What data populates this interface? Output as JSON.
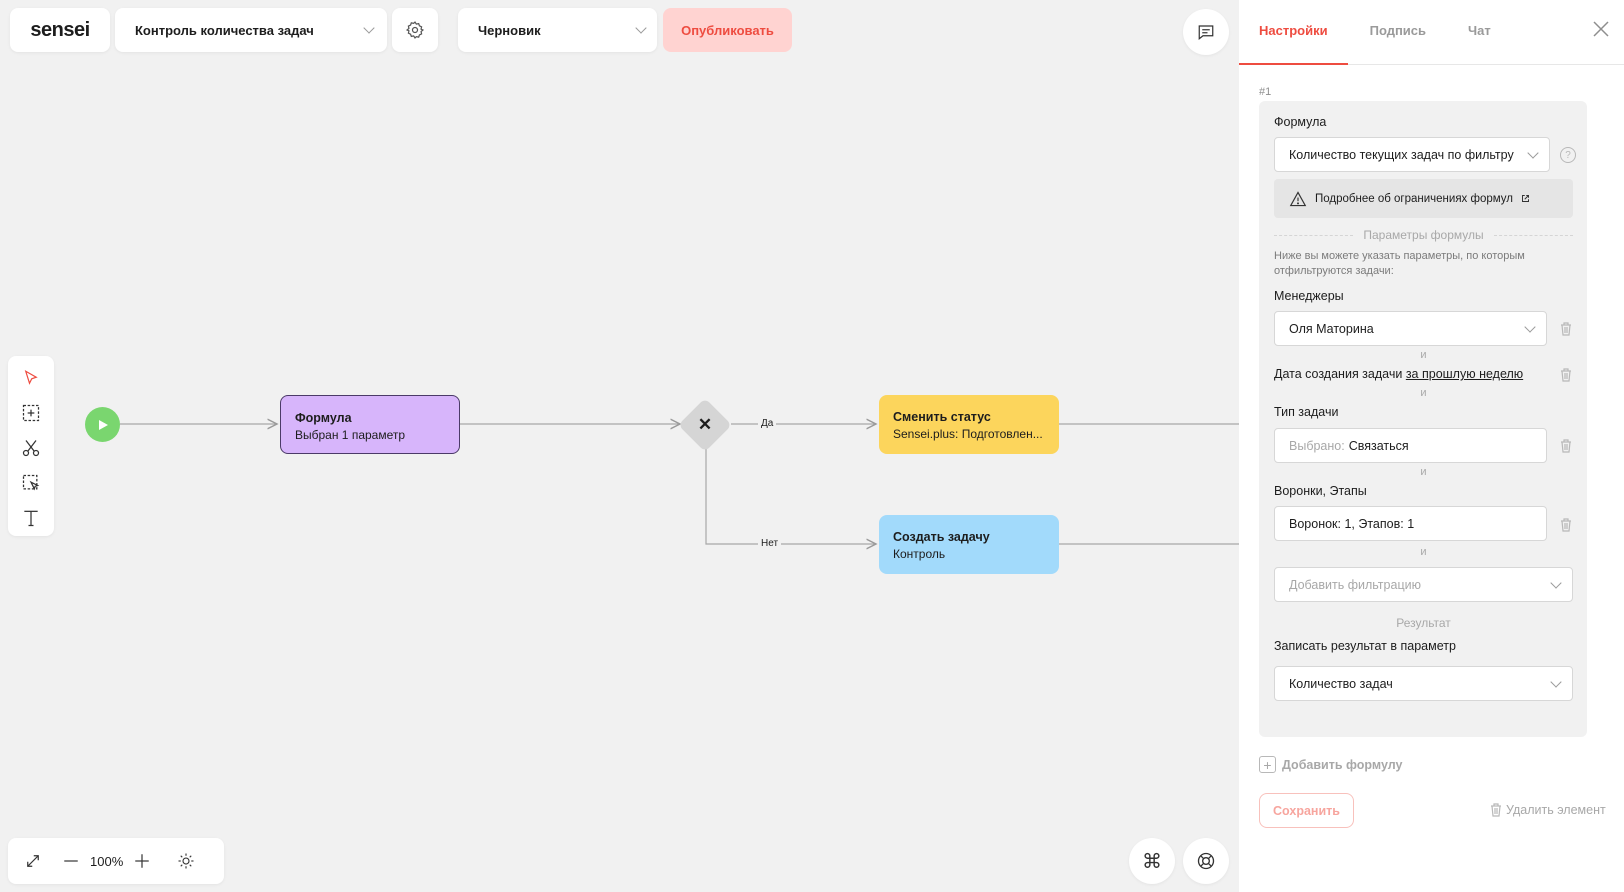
{
  "brand": "sensei",
  "header": {
    "process_name": "Контроль количества задач",
    "status": "Черновик",
    "publish_label": "Опубликовать"
  },
  "canvas": {
    "nodes": {
      "formula": {
        "title": "Формула",
        "subtitle": "Выбран 1 параметр"
      },
      "change_status": {
        "title": "Сменить статус",
        "subtitle": "Sensei.plus: Подготовлен..."
      },
      "create_task": {
        "title": "Создать задачу",
        "subtitle": "Контроль"
      }
    },
    "edges": {
      "yes": "Да",
      "no": "Нет"
    },
    "zoom": "100%"
  },
  "panel": {
    "tabs": [
      "Настройки",
      "Подпись",
      "Чат"
    ],
    "active_tab": "Настройки",
    "index": "#1",
    "formula_label": "Формула",
    "formula_value": "Количество текущих задач по фильтру",
    "help_mark": "?",
    "warning_text": "Подробнее об ограничениях формул",
    "params_divider": "Параметры формулы",
    "params_desc": "Ниже вы можете указать параметры, по которым отфильтруются задачи:",
    "managers_label": "Менеджеры",
    "managers_value": "Оля Маторина",
    "and": "и",
    "date_label": "Дата создания задачи",
    "date_value": "за прошлую неделю",
    "task_type_label": "Тип задачи",
    "task_type_prefix": "Выбрано:",
    "task_type_value": "Связаться",
    "funnels_label": "Воронки, Этапы",
    "funnels_value": "Воронок: 1, Этапов: 1",
    "add_filter_placeholder": "Добавить фильтрацию",
    "result_divider": "Результат",
    "result_label": "Записать результат в параметр",
    "result_value": "Количество задач",
    "add_formula": "Добавить формулу",
    "save": "Сохранить",
    "delete": "Удалить элемент"
  },
  "colors": {
    "accent": "#ee4c40",
    "formula_node": "#d7b5fb",
    "status_node": "#fcd55c",
    "task_node": "#a2dafb",
    "start_node": "#7ad66f"
  }
}
